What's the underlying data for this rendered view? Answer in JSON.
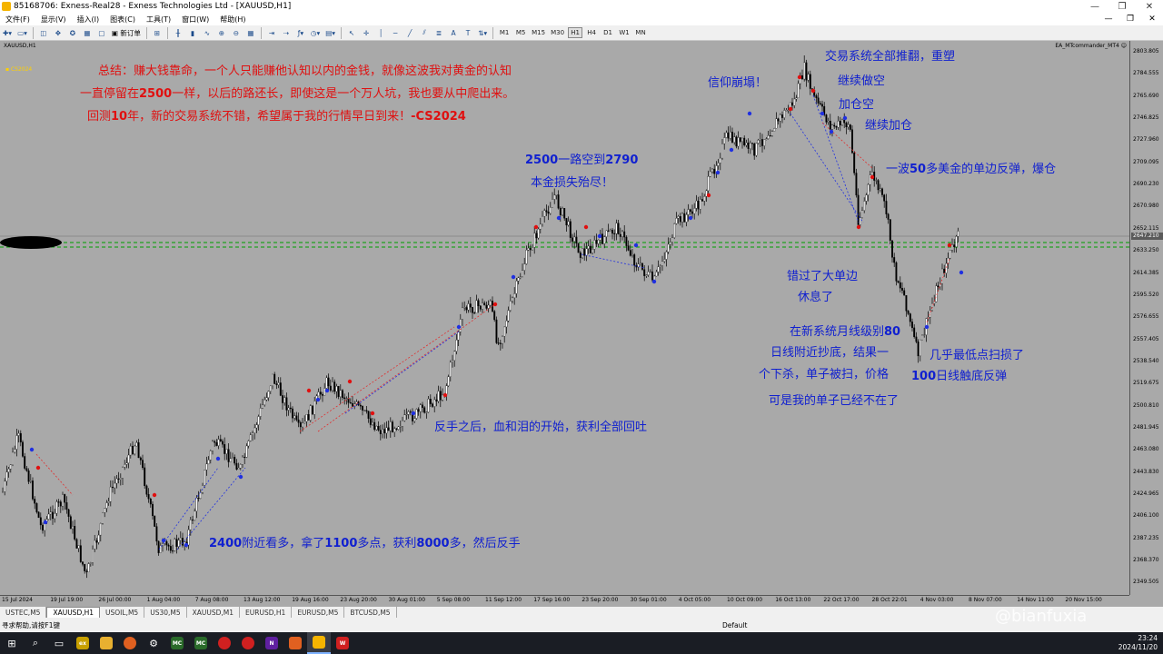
{
  "window": {
    "title": "85168706: Exness-Real28 - Exness Technologies Ltd - [XAUUSD,H1]",
    "controls": [
      "—",
      "❐",
      "✕"
    ]
  },
  "menu": {
    "items": [
      "文件(F)",
      "显示(V)",
      "插入(I)",
      "图表(C)",
      "工具(T)",
      "窗口(W)",
      "帮助(H)"
    ],
    "mdi": [
      "—",
      "❐",
      "✕"
    ]
  },
  "toolbar": {
    "new_order": "新订单",
    "timeframes": [
      "M1",
      "M5",
      "M15",
      "M30",
      "H1",
      "H4",
      "D1",
      "W1",
      "MN"
    ],
    "active_timeframe": "H1"
  },
  "chart": {
    "symbol_label": "XAUUSD,H1",
    "ea_label": "EA_MTcommander_MT4 ☺",
    "cs_label": "CS2024",
    "current_price": "2647.210",
    "price_ticks": [
      "2803.805",
      "2784.555",
      "2765.690",
      "2746.825",
      "2727.960",
      "2709.095",
      "2690.230",
      "2670.980",
      "2652.115",
      "2633.250",
      "2614.385",
      "2595.520",
      "2576.655",
      "2557.405",
      "2538.540",
      "2519.675",
      "2500.810",
      "2481.945",
      "2463.080",
      "2443.830",
      "2424.965",
      "2406.100",
      "2387.235",
      "2368.370",
      "2349.505"
    ],
    "time_ticks": [
      "15 Jul 2024",
      "19 Jul 19:00",
      "26 Jul 00:00",
      "1 Aug 04:00",
      "7 Aug 08:00",
      "13 Aug 12:00",
      "19 Aug 16:00",
      "23 Aug 20:00",
      "30 Aug 01:00",
      "5 Sep 08:00",
      "11 Sep 12:00",
      "17 Sep 16:00",
      "23 Sep 20:00",
      "30 Sep 01:00",
      "4 Oct 05:00",
      "10 Oct 09:00",
      "16 Oct 13:00",
      "22 Oct 17:00",
      "28 Oct 22:01",
      "4 Nov 03:00",
      "8 Nov 07:00",
      "14 Nov 11:00",
      "20 Nov 15:00"
    ]
  },
  "annotations": {
    "summary_1": "总结：赚大钱靠命，一个人只能赚他认知以内的金钱，就像这波我对黄金的认知",
    "summary_2a": "一直停留在",
    "summary_2b": "2500",
    "summary_2c": "一样，以后的路还长，即使这是一个万人坑，我也要从中爬出来。",
    "summary_3a": "回测",
    "summary_3b": "10",
    "summary_3c": "年，新的交易系统不错，希望属于我的行情早日到来！",
    "summary_3d": "-CS2024",
    "short_2500a": "2500",
    "short_2500b": "一路空到",
    "short_2500c": "2790",
    "principal_lost": "本金损失殆尽！",
    "faith_collapse": "信仰崩塌！",
    "system_overturn": "交易系统全部推翻，重塑",
    "keep_short": "继续做空",
    "add_short": "加仓空",
    "keep_add": "继续加仓",
    "rebound_a": "一波",
    "rebound_b": "50",
    "rebound_c": "多美金的单边反弹，爆仓",
    "missed_big": "错过了大单边",
    "rest": "休息了",
    "new_system_a": "在新系统月线级别",
    "new_system_b": "80",
    "daily_bottom": "日线附近抄底，结果一",
    "drop_swept": "个下杀，单子被扫，价格",
    "order_gone": "可是我的单子已经不在了",
    "almost_low": "几乎最低点扫损了",
    "ma100_a": "100",
    "ma100_b": "日线触底反弹",
    "reverse_start": "反手之后，血和泪的开始，获利全部回吐",
    "long_2400a": "2400",
    "long_2400b": "附近看多，拿了",
    "long_2400c": "1100",
    "long_2400d": "多点，获利",
    "long_2400e": "8000",
    "long_2400f": "多，然后反手"
  },
  "tabs": [
    "USTEC,M5",
    "XAUUSD,H1",
    "USOIL,M5",
    "US30,M5",
    "XAUUSD,M1",
    "EURUSD,H1",
    "EURUSD,M5",
    "BTCUSD,M5"
  ],
  "active_tab": "XAUUSD,H1",
  "status": {
    "help": "寻求帮助,请按F1键",
    "profile": "Default"
  },
  "watermark": "@bianfuxia",
  "taskbar": {
    "time": "23:24",
    "date": "2024/11/20"
  },
  "colors": {
    "chart_bg": "#a9a9a9",
    "annotation_red": "#e01010",
    "annotation_blue": "#1020d0",
    "level_line": "#00a000"
  }
}
